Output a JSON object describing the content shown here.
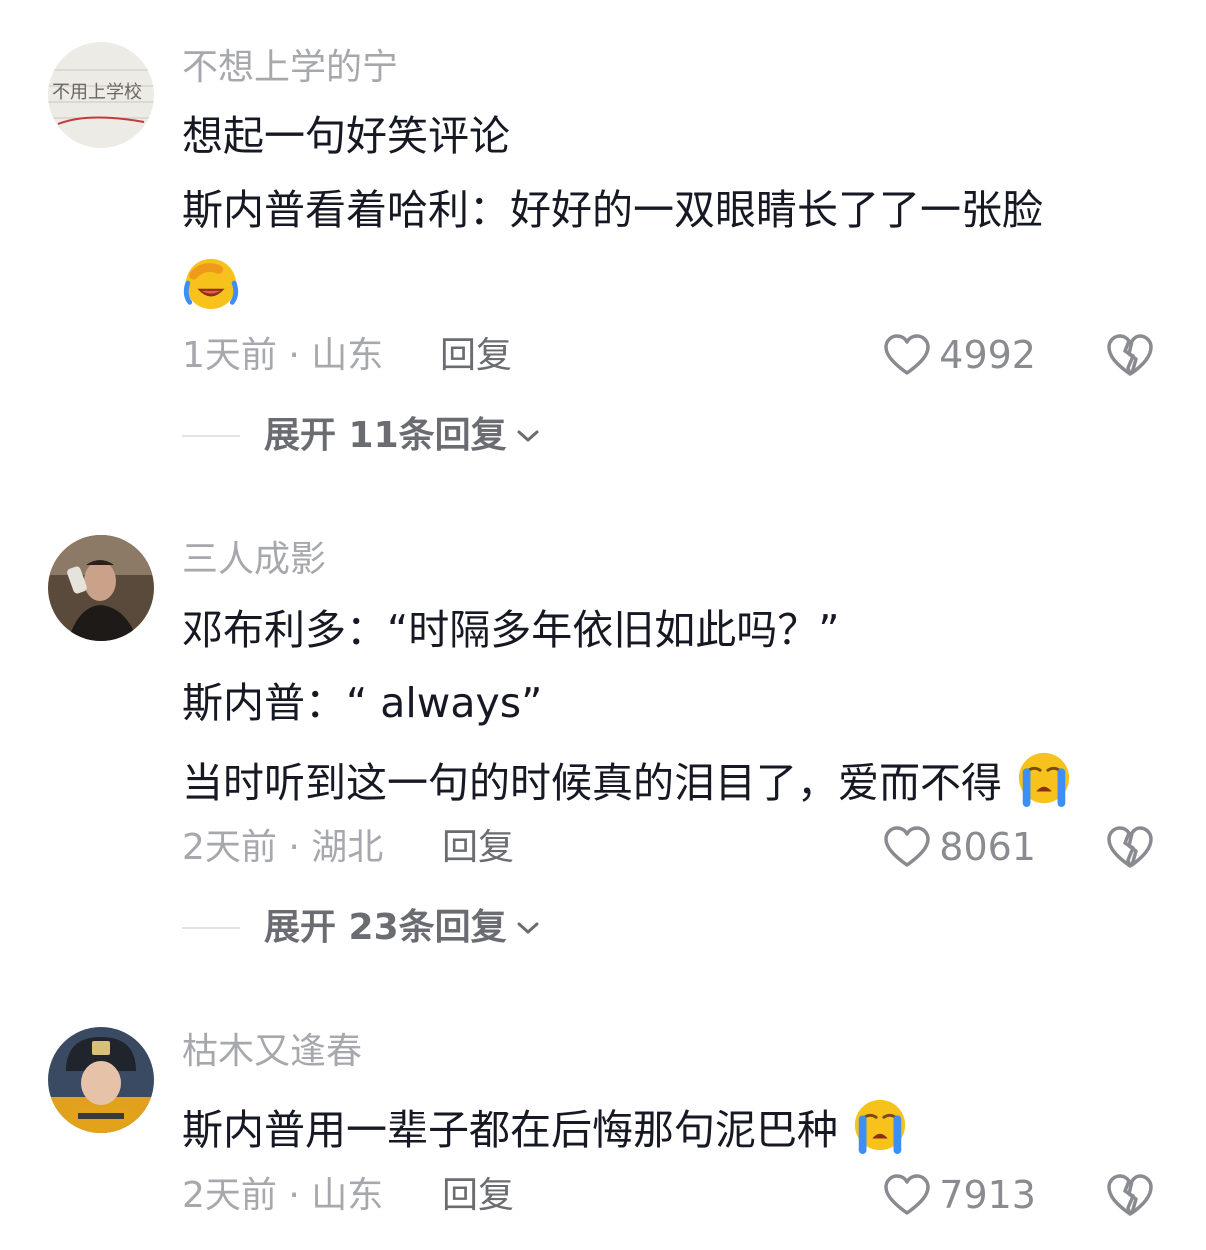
{
  "comments": [
    {
      "username": "不想上学的宁",
      "avatar_text": "不用上学校",
      "lines": [
        "想起一句好笑评论",
        "斯内普看着哈利：好好的一双眼睛长了了一张脸"
      ],
      "emoji_line_emoji": "facepalm-laugh-emoji",
      "meta": "1天前 · 山东",
      "reply_label": "回复",
      "likes": "4992",
      "expand_label": "展开 11条回复"
    },
    {
      "username": "三人成影",
      "lines": [
        "邓布利多：“时隔多年依旧如此吗？”",
        "斯内普：“ always”",
        "当时听到这一句的时候真的泪目了，爱而不得"
      ],
      "emoji_line_emoji": "crying-emoji",
      "meta": "2天前 · 湖北",
      "reply_label": "回复",
      "likes": "8061",
      "expand_label": "展开 23条回复"
    },
    {
      "username": "枯木又逢春",
      "lines": [
        "斯内普用一辈子都在后悔那句泥巴种"
      ],
      "emoji_line_emoji": "crying-emoji",
      "meta": "2天前 · 山东",
      "reply_label": "回复",
      "likes": "7913"
    }
  ],
  "colors": {
    "text": "#161823",
    "secondary": "#a7a8ad",
    "emoji_yellow": "#f7c21b",
    "emoji_tear": "#3d8ff5"
  }
}
